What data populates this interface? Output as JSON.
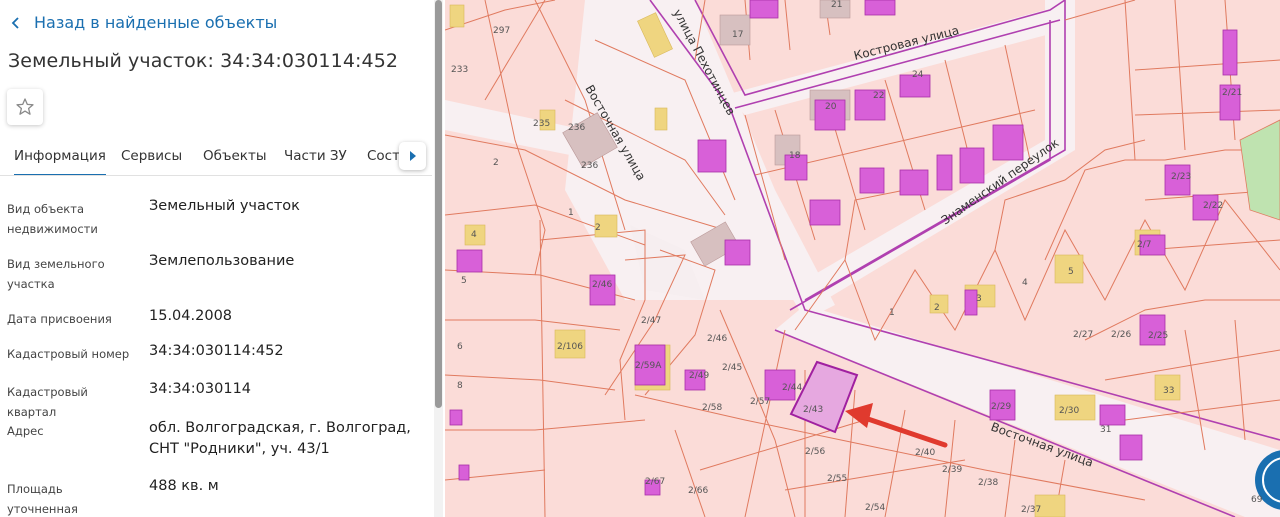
{
  "panel": {
    "back_label": "Назад в найденные объекты",
    "title": "Земельный участок: 34:34:030114:452",
    "tabs": [
      "Информация",
      "Сервисы",
      "Объекты",
      "Части ЗУ",
      "Соста"
    ],
    "active_tab": "Информация",
    "properties": [
      {
        "label": "Вид объекта недвижимости",
        "value": "Земельный участок"
      },
      {
        "label": "Вид земельного участка",
        "value": "Землепользование"
      },
      {
        "label": "Дата присвоения",
        "value": "15.04.2008"
      },
      {
        "label": "Кадастровый номер",
        "value": "34:34:030114:452"
      },
      {
        "label": "Кадастровый квартал",
        "value": "34:34:030114"
      },
      {
        "label": "Адрес",
        "value": "обл. Волгоградская, г. Волгоград, СНТ \"Родники\", уч. 43/1"
      },
      {
        "label": "Площадь уточненная",
        "value": "488 кв. м"
      }
    ]
  },
  "map": {
    "streets": [
      "Костровая улица",
      "улица Пехотинцев",
      "Восточная улица",
      "Знаменский переулок",
      "Восточная улица"
    ],
    "parcel_labels": [
      "17",
      "21",
      "20",
      "22",
      "24",
      "18",
      "297",
      "233",
      "235",
      "236",
      "236",
      "2",
      "1",
      "2",
      "4",
      "5",
      "6",
      "8",
      "2/46",
      "2/47",
      "2/106",
      "2/59А",
      "2/49",
      "2/46",
      "2/45",
      "2/58",
      "2/57",
      "2/44",
      "2/43",
      "2/56",
      "2/55",
      "2/54",
      "2/67",
      "2/66",
      "2/40",
      "2/39",
      "2/38",
      "2/37",
      "2/30",
      "2/29",
      "31",
      "1",
      "2",
      "3",
      "4",
      "5",
      "2/7",
      "2/27",
      "2/26",
      "2/25",
      "33",
      "2/21",
      "2/22",
      "2/23",
      "69"
    ],
    "highlighted_parcel": "2/43",
    "colors": {
      "background": "#fbdcd8",
      "parcel_border": "#e07a5f",
      "building": "#d860d8",
      "building_border": "#a830a8",
      "road": "#f7f2f4",
      "boundary": "#b040b0",
      "yellow": "#efd580",
      "grey_building": "#d7c0c0",
      "arrow": "#e03a2e",
      "highlight_fill": "#e6a8e0",
      "highlight_border": "#a020a0"
    }
  }
}
